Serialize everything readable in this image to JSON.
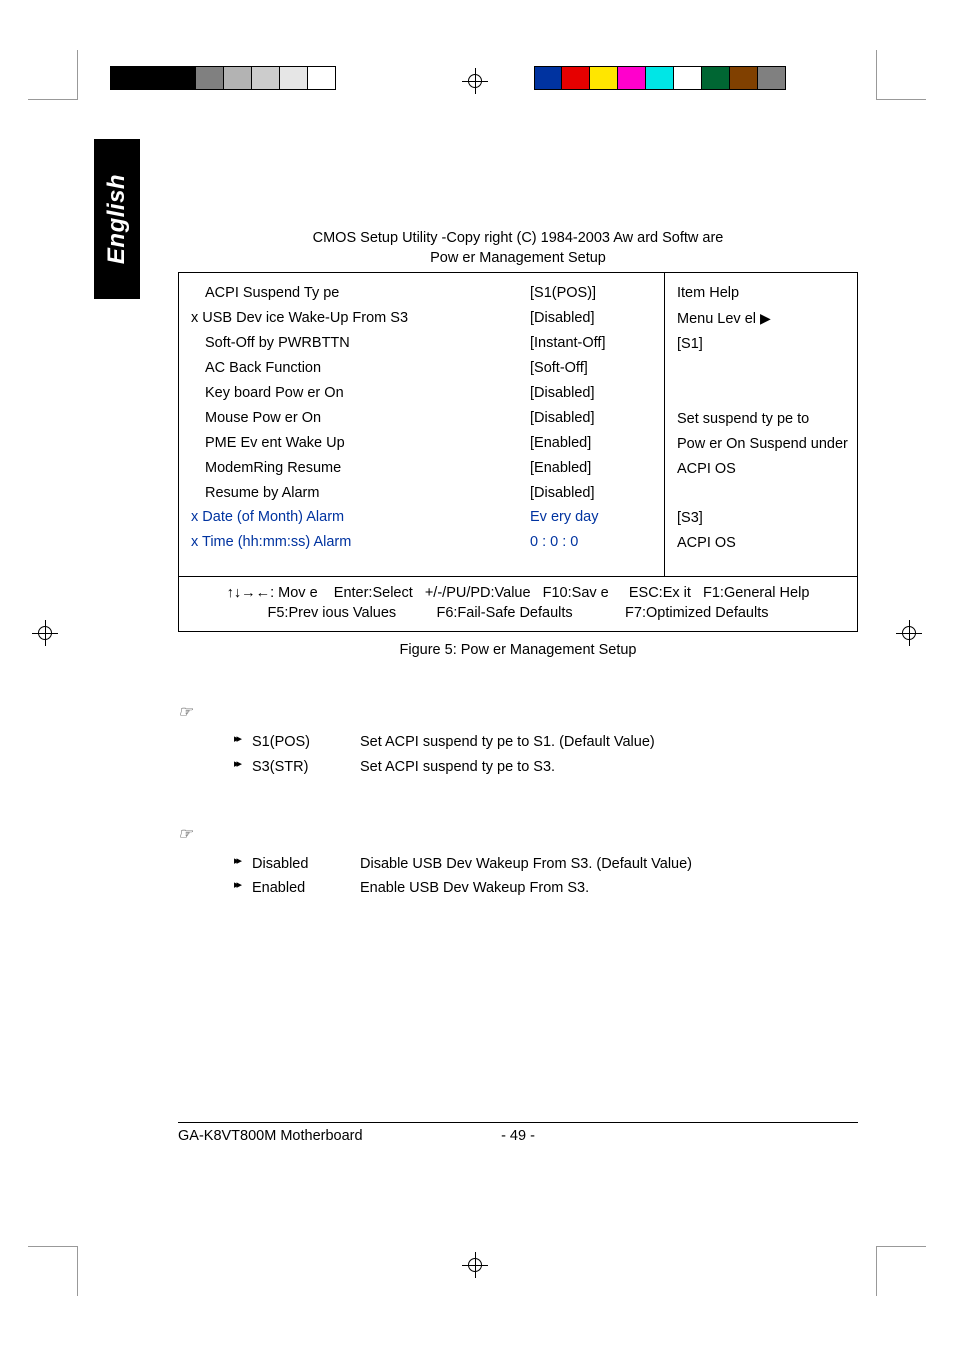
{
  "lang_tab": "English",
  "bios": {
    "title": "CMOS Setup Utility -Copy right (C) 1984-2003 Aw ard Softw are",
    "subtitle": "Pow er Management Setup",
    "items": [
      {
        "label": "ACPI Suspend Ty pe",
        "value": "[S1(POS)]",
        "prefix": "",
        "inactive": false
      },
      {
        "label": "USB Dev ice Wake-Up From S3",
        "value": "[Disabled]",
        "prefix": "x ",
        "inactive": false
      },
      {
        "label": "Soft-Off by PWRBTTN",
        "value": "[Instant-Off]",
        "prefix": "",
        "inactive": false
      },
      {
        "label": "AC Back Function",
        "value": "[Soft-Off]",
        "prefix": "",
        "inactive": false
      },
      {
        "label": "Key board Pow er On",
        "value": "[Disabled]",
        "prefix": "",
        "inactive": false
      },
      {
        "label": "Mouse Pow er On",
        "value": "[Disabled]",
        "prefix": "",
        "inactive": false
      },
      {
        "label": "PME Ev ent Wake Up",
        "value": "[Enabled]",
        "prefix": "",
        "inactive": false
      },
      {
        "label": "ModemRing Resume",
        "value": "[Enabled]",
        "prefix": "",
        "inactive": false
      },
      {
        "label": "Resume by Alarm",
        "value": "[Disabled]",
        "prefix": "",
        "inactive": false
      },
      {
        "label": "Date (of Month) Alarm",
        "value": "Ev ery day",
        "prefix": "x ",
        "inactive": true
      },
      {
        "label": "Time (hh:mm:ss) Alarm",
        "value": "0 : 0 : 0",
        "prefix": "x ",
        "inactive": true
      }
    ],
    "help": {
      "title": "Item Help",
      "menu_level": "Menu Lev el",
      "lines": [
        "[S1]",
        "",
        "",
        "Set suspend ty pe to",
        "Pow er On Suspend under",
        "ACPI OS",
        "",
        "[S3]",
        "ACPI OS"
      ]
    },
    "nav1": "↑↓→←: Mov e    Enter:Select   +/-/PU/PD:Value   F10:Sav e     ESC:Ex it   F1:General Help",
    "nav2": "F5:Prev ious Values          F6:Fail-Safe Defaults             F7:Optimized Defaults"
  },
  "figure_caption": "Figure 5: Pow er Management Setup",
  "sections": [
    {
      "options": [
        {
          "key": "S1(POS)",
          "desc": "Set ACPI suspend ty pe to S1. (Default Value)"
        },
        {
          "key": "S3(STR)",
          "desc": "Set ACPI suspend ty pe to S3."
        }
      ]
    },
    {
      "options": [
        {
          "key": "Disabled",
          "desc": "Disable USB Dev Wakeup From S3. (Default Value)"
        },
        {
          "key": "Enabled",
          "desc": "Enable USB Dev Wakeup From S3."
        }
      ]
    }
  ],
  "footer": {
    "left": "GA-K8VT800M Motherboard",
    "center": "- 49 -"
  },
  "colorbars": {
    "left": [
      "#000000",
      "#000000",
      "#808080",
      "#b3b3b3",
      "#cccccc",
      "#e6e6e6",
      "#ffffff"
    ],
    "right": [
      "#0033a0",
      "#e60000",
      "#ffe600",
      "#ff00cc",
      "#00e6e6",
      "#ffffff",
      "#006633",
      "#804000",
      "#808080"
    ]
  }
}
